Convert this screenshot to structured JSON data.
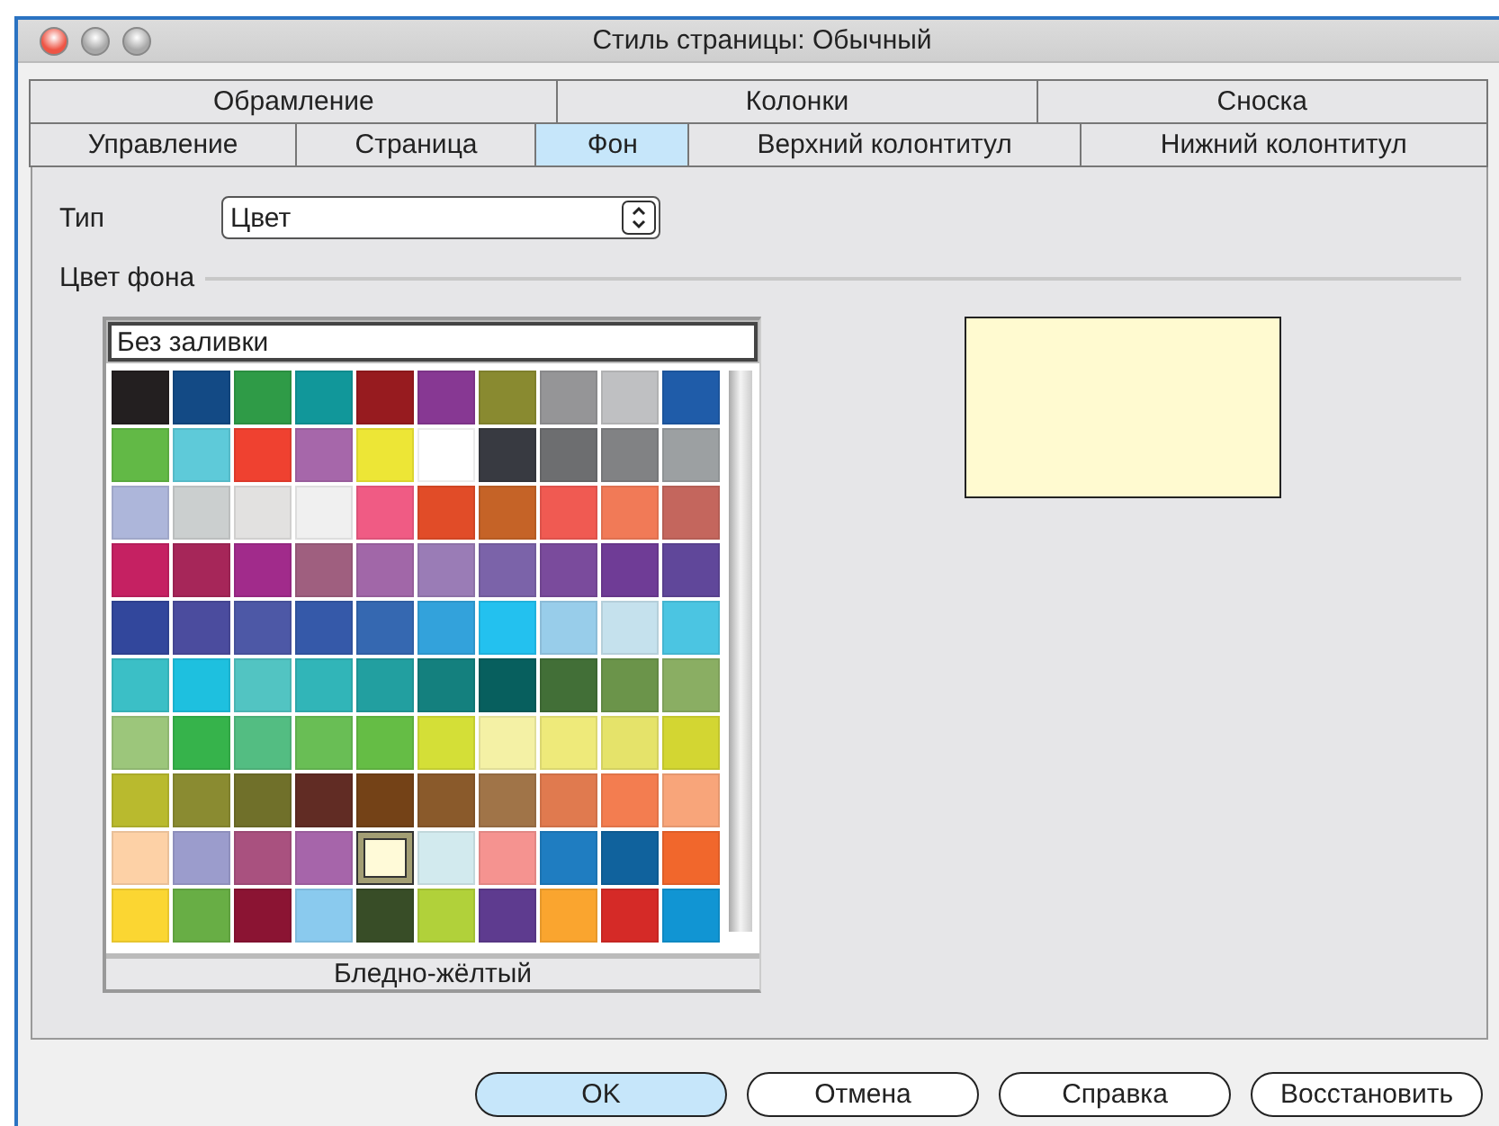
{
  "window": {
    "title": "Стиль страницы: Обычный"
  },
  "tab_rows": [
    [
      {
        "label": "Обрамление",
        "selected": false
      },
      {
        "label": "Колонки",
        "selected": false
      },
      {
        "label": "Сноска",
        "selected": false
      }
    ],
    [
      {
        "label": "Управление",
        "selected": false
      },
      {
        "label": "Страница",
        "selected": false
      },
      {
        "label": "Фон",
        "selected": true
      },
      {
        "label": "Верхний колонтитул",
        "selected": false
      },
      {
        "label": "Нижний колонтитул",
        "selected": false
      }
    ]
  ],
  "type": {
    "label": "Тип",
    "value": "Цвет"
  },
  "section_title": "Цвет фона",
  "palette": {
    "none_option": "Без заливки",
    "selected_name": "Бледно-жёлтый",
    "swatches": [
      {
        "color": "#231f20",
        "selected": false
      },
      {
        "color": "#134a85",
        "selected": false
      },
      {
        "color": "#2f9b47",
        "selected": false
      },
      {
        "color": "#11979a",
        "selected": false
      },
      {
        "color": "#971b1f",
        "selected": false
      },
      {
        "color": "#873893",
        "selected": false
      },
      {
        "color": "#898a30",
        "selected": false
      },
      {
        "color": "#959597",
        "selected": false
      },
      {
        "color": "#bfc0c2",
        "selected": false
      },
      {
        "color": "#1f5ca9",
        "selected": false
      },
      {
        "color": "#62b946",
        "selected": false
      },
      {
        "color": "#5ecad9",
        "selected": false
      },
      {
        "color": "#ef4130",
        "selected": false
      },
      {
        "color": "#a667aa",
        "selected": false
      },
      {
        "color": "#ede636",
        "selected": false
      },
      {
        "color": "#ffffff",
        "selected": false
      },
      {
        "color": "#383a41",
        "selected": false
      },
      {
        "color": "#6d6e70",
        "selected": false
      },
      {
        "color": "#818284",
        "selected": false
      },
      {
        "color": "#9ca0a2",
        "selected": false
      },
      {
        "color": "#adb6da",
        "selected": false
      },
      {
        "color": "#cbcfcf",
        "selected": false
      },
      {
        "color": "#e2e1e0",
        "selected": false
      },
      {
        "color": "#f0f0f0",
        "selected": false
      },
      {
        "color": "#f05b84",
        "selected": false
      },
      {
        "color": "#e14c28",
        "selected": false
      },
      {
        "color": "#c56327",
        "selected": false
      },
      {
        "color": "#f05a52",
        "selected": false
      },
      {
        "color": "#f17a57",
        "selected": false
      },
      {
        "color": "#c4665d",
        "selected": false
      },
      {
        "color": "#c52162",
        "selected": false
      },
      {
        "color": "#a62659",
        "selected": false
      },
      {
        "color": "#a12b8b",
        "selected": false
      },
      {
        "color": "#9f5f7f",
        "selected": false
      },
      {
        "color": "#a167a8",
        "selected": false
      },
      {
        "color": "#9a7cb6",
        "selected": false
      },
      {
        "color": "#7b63a9",
        "selected": false
      },
      {
        "color": "#7a4b9c",
        "selected": false
      },
      {
        "color": "#6f3c96",
        "selected": false
      },
      {
        "color": "#60479a",
        "selected": false
      },
      {
        "color": "#32479c",
        "selected": false
      },
      {
        "color": "#4b4c9e",
        "selected": false
      },
      {
        "color": "#4d58a6",
        "selected": false
      },
      {
        "color": "#3559a9",
        "selected": false
      },
      {
        "color": "#3568b1",
        "selected": false
      },
      {
        "color": "#33a2db",
        "selected": false
      },
      {
        "color": "#23c1ef",
        "selected": false
      },
      {
        "color": "#98cdea",
        "selected": false
      },
      {
        "color": "#c5e1ed",
        "selected": false
      },
      {
        "color": "#4bc5e2",
        "selected": false
      },
      {
        "color": "#3bbfc6",
        "selected": false
      },
      {
        "color": "#1ec0df",
        "selected": false
      },
      {
        "color": "#52c4c2",
        "selected": false
      },
      {
        "color": "#31b5b8",
        "selected": false
      },
      {
        "color": "#229fa0",
        "selected": false
      },
      {
        "color": "#14807e",
        "selected": false
      },
      {
        "color": "#075f5e",
        "selected": false
      },
      {
        "color": "#426f37",
        "selected": false
      },
      {
        "color": "#6b944a",
        "selected": false
      },
      {
        "color": "#8aae63",
        "selected": false
      },
      {
        "color": "#9cc67b",
        "selected": false
      },
      {
        "color": "#36b34b",
        "selected": false
      },
      {
        "color": "#53bd82",
        "selected": false
      },
      {
        "color": "#69be55",
        "selected": false
      },
      {
        "color": "#65bd45",
        "selected": false
      },
      {
        "color": "#d4df37",
        "selected": false
      },
      {
        "color": "#f4f1a5",
        "selected": false
      },
      {
        "color": "#eeea7a",
        "selected": false
      },
      {
        "color": "#e5e36a",
        "selected": false
      },
      {
        "color": "#d3d632",
        "selected": false
      },
      {
        "color": "#b9ba2e",
        "selected": false
      },
      {
        "color": "#8a8b31",
        "selected": false
      },
      {
        "color": "#70702a",
        "selected": false
      },
      {
        "color": "#612c24",
        "selected": false
      },
      {
        "color": "#744217",
        "selected": false
      },
      {
        "color": "#8a5a2b",
        "selected": false
      },
      {
        "color": "#a07448",
        "selected": false
      },
      {
        "color": "#e07a4f",
        "selected": false
      },
      {
        "color": "#f37d50",
        "selected": false
      },
      {
        "color": "#f8a57a",
        "selected": false
      },
      {
        "color": "#fdd1a6",
        "selected": false
      },
      {
        "color": "#9b9ccc",
        "selected": false
      },
      {
        "color": "#a9517f",
        "selected": false
      },
      {
        "color": "#a665aa",
        "selected": false
      },
      {
        "color": "#fffad8",
        "selected": true
      },
      {
        "color": "#d2eaee",
        "selected": false
      },
      {
        "color": "#f59390",
        "selected": false
      },
      {
        "color": "#1f7dc1",
        "selected": false
      },
      {
        "color": "#10629d",
        "selected": false
      },
      {
        "color": "#f1672c",
        "selected": false
      },
      {
        "color": "#fbd632",
        "selected": false
      },
      {
        "color": "#68ae45",
        "selected": false
      },
      {
        "color": "#8b1433",
        "selected": false
      },
      {
        "color": "#8acaee",
        "selected": false
      },
      {
        "color": "#384d27",
        "selected": false
      },
      {
        "color": "#b1d13a",
        "selected": false
      },
      {
        "color": "#5e3b8f",
        "selected": false
      },
      {
        "color": "#faa52f",
        "selected": false
      },
      {
        "color": "#d52a27",
        "selected": false
      },
      {
        "color": "#1195d3",
        "selected": false
      }
    ]
  },
  "preview": {
    "color": "#fffad0"
  },
  "buttons": [
    {
      "label": "OK",
      "default": true
    },
    {
      "label": "Отмена",
      "default": false
    },
    {
      "label": "Справка",
      "default": false
    },
    {
      "label": "Восстановить",
      "default": false
    }
  ]
}
